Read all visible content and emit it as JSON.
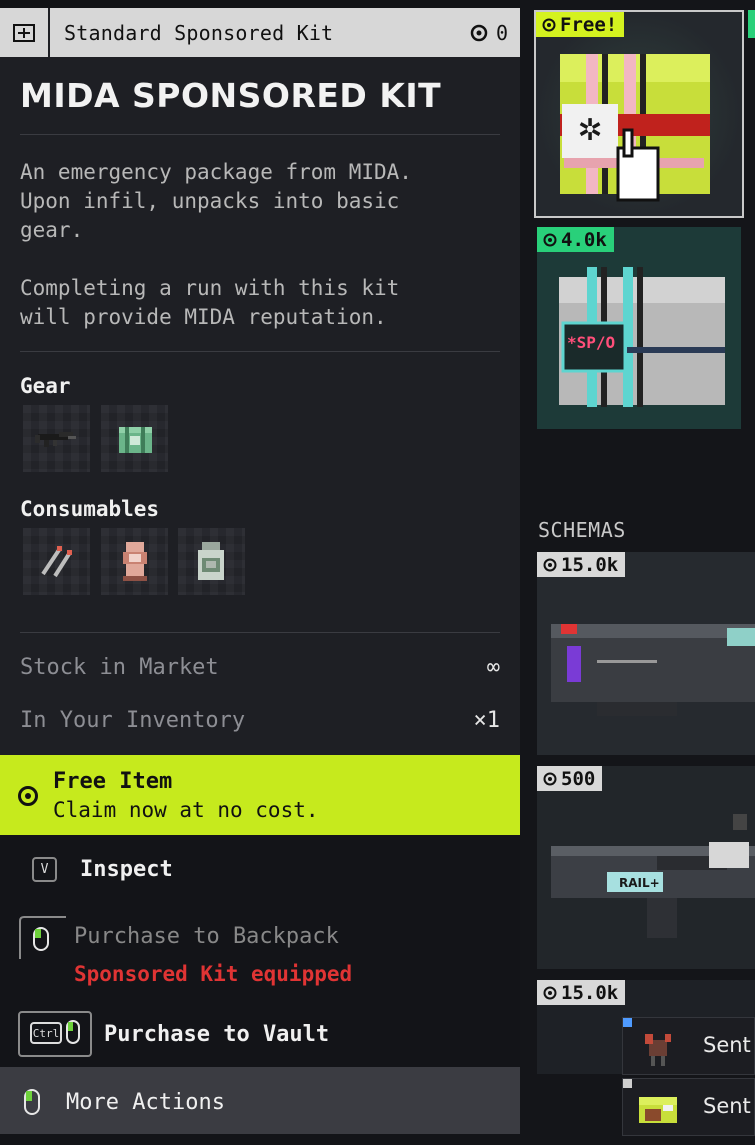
{
  "header": {
    "title": "Standard Sponsored Kit",
    "cost": "0"
  },
  "item": {
    "name": "MIDA SPONSORED KIT",
    "description": "An emergency package from MIDA.\nUpon infil, unpacks into basic\ngear.\n\nCompleting a run with this kit\nwill provide MIDA reputation."
  },
  "gear": {
    "label": "Gear",
    "items": [
      "rifle-icon",
      "green-kit-icon"
    ]
  },
  "consumables": {
    "label": "Consumables",
    "items": [
      "injector-icon",
      "stim-icon",
      "jar-icon"
    ]
  },
  "stats": [
    {
      "label": "Stock in Market",
      "value": "∞"
    },
    {
      "label": "In Your Inventory",
      "value": "×1"
    }
  ],
  "free_banner": {
    "title": "Free Item",
    "subtitle": "Claim now at no cost."
  },
  "actions": {
    "inspect": {
      "key": "V",
      "label": "Inspect"
    },
    "backpack": {
      "label": "Purchase to Backpack",
      "warning": "Sponsored Kit equipped"
    },
    "vault": {
      "key": "Ctrl",
      "label": "Purchase to Vault"
    },
    "more": {
      "label": "More Actions"
    }
  },
  "cards": [
    {
      "price": "Free!"
    },
    {
      "price": "4.0k",
      "label": "*SP/O"
    }
  ],
  "schemas": {
    "title": "SCHEMAS",
    "items": [
      {
        "price": "15.0k"
      },
      {
        "price": "500",
        "gun_label": "RAIL+"
      },
      {
        "price": "15.0k",
        "rows": [
          "Sent",
          "Sent"
        ]
      }
    ]
  },
  "colors": {
    "accent_lime": "#c6ea1d",
    "price_green": "#29d07a",
    "warning_red": "#e03434"
  }
}
